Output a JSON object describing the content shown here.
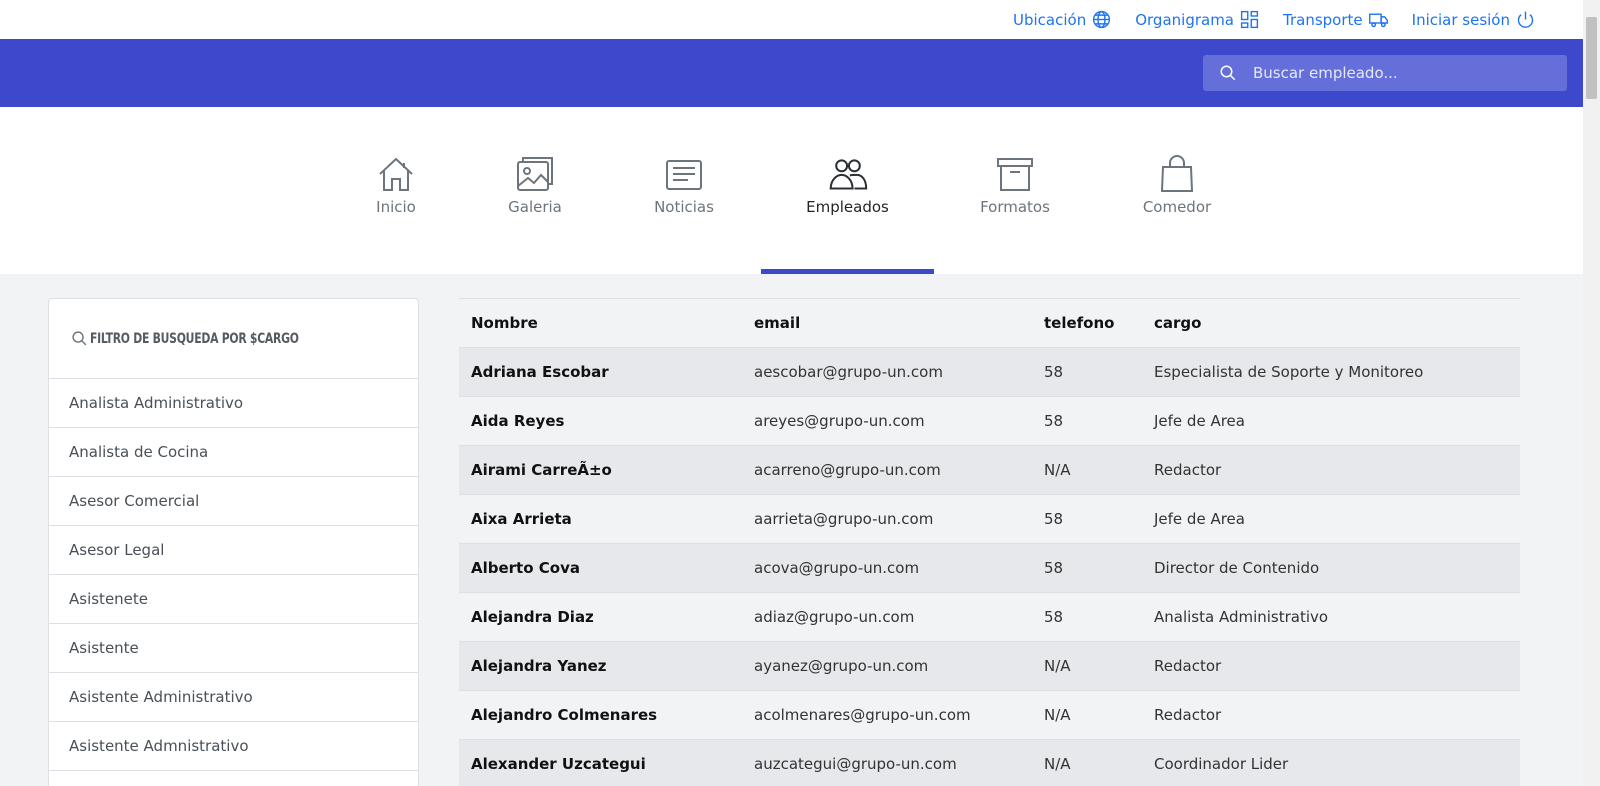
{
  "top_links": [
    {
      "label": "Ubicación",
      "icon": "globe-icon"
    },
    {
      "label": "Organigrama",
      "icon": "grid-icon"
    },
    {
      "label": "Transporte",
      "icon": "truck-icon"
    },
    {
      "label": "Iniciar sesión",
      "icon": "power-icon"
    }
  ],
  "search": {
    "placeholder": "Buscar empleado..."
  },
  "nav_tabs": [
    {
      "label": "Inicio",
      "icon": "home-icon",
      "active": false
    },
    {
      "label": "Galeria",
      "icon": "images-icon",
      "active": false
    },
    {
      "label": "Noticias",
      "icon": "news-icon",
      "active": false
    },
    {
      "label": "Empleados",
      "icon": "people-icon",
      "active": true
    },
    {
      "label": "Formatos",
      "icon": "archive-icon",
      "active": false
    },
    {
      "label": "Comedor",
      "icon": "bag-icon",
      "active": false
    }
  ],
  "filter": {
    "title": "Filtro de busqueda por $cargo",
    "items": [
      "Analista Administrativo",
      "Analista de Cocina",
      "Asesor Comercial",
      "Asesor Legal",
      "Asistenete",
      "Asistente",
      "Asistente Administrativo",
      "Asistente Admnistrativo"
    ]
  },
  "table": {
    "headers": [
      "Nombre",
      "email",
      "telefono",
      "cargo"
    ],
    "rows": [
      [
        "Adriana Escobar",
        "aescobar@grupo-un.com",
        "58",
        "Especialista de Soporte y Monitoreo"
      ],
      [
        "Aida Reyes",
        "areyes@grupo-un.com",
        "58",
        "Jefe de Area"
      ],
      [
        "Airami CarreÃ±o",
        "acarreno@grupo-un.com",
        "N/A",
        "Redactor"
      ],
      [
        "Aixa Arrieta",
        "aarrieta@grupo-un.com",
        "58",
        "Jefe de Area"
      ],
      [
        "Alberto Cova",
        "acova@grupo-un.com",
        "58",
        "Director de Contenido"
      ],
      [
        "Alejandra Diaz",
        "adiaz@grupo-un.com",
        "58",
        "Analista Administrativo"
      ],
      [
        "Alejandra Yanez",
        "ayanez@grupo-un.com",
        "N/A",
        "Redactor"
      ],
      [
        "Alejandro Colmenares",
        "acolmenares@grupo-un.com",
        "N/A",
        "Redactor"
      ],
      [
        "Alexander Uzcategui",
        "auzcategui@grupo-un.com",
        "N/A",
        "Coordinador Lider"
      ]
    ]
  },
  "colors": {
    "header_bg": "#3d48cd",
    "link": "#1e74f0",
    "active_underline": "#3d48cd"
  }
}
